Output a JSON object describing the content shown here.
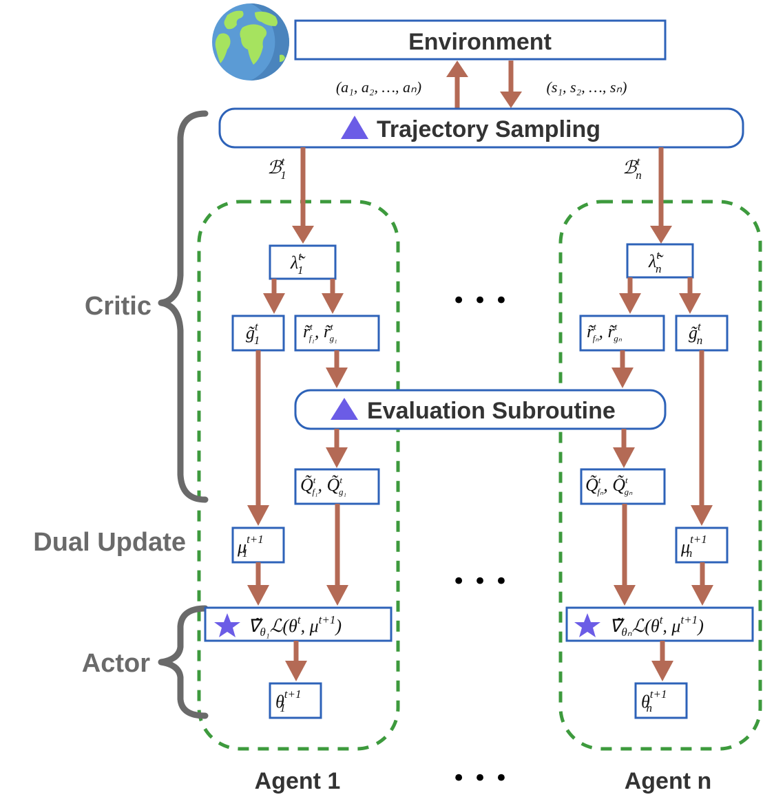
{
  "environment": {
    "title": "Environment",
    "icon": "globe-icon",
    "actions_label": "(a₁, a₂, …, aₙ)",
    "states_label": "(s₁, s₂, …, sₙ)"
  },
  "trajectory_sampling": {
    "label": "Trajectory Sampling",
    "icon": "triangle-icon"
  },
  "evaluation_subroutine": {
    "label": "Evaluation Subroutine",
    "icon": "triangle-icon"
  },
  "phases": {
    "critic": "Critic",
    "dual_update": "Dual Update",
    "actor": "Actor"
  },
  "agents": [
    {
      "name": "Agent 1",
      "batch": {
        "base": "ℬ",
        "sup": "t",
        "sub": "1"
      },
      "lambda": {
        "base": "λ̃",
        "sup": "t",
        "sub": "1"
      },
      "g": {
        "base": "g̃",
        "sup": "t",
        "sub": "1"
      },
      "r": {
        "base1": "r̃",
        "sup1": "t",
        "sub1": "f₁",
        "base2": "r̃",
        "sup2": "t",
        "sub2": "g₁"
      },
      "q": {
        "base1": "Q̃",
        "sup1": "t",
        "sub1": "f₁",
        "base2": "Q̃",
        "sup2": "t",
        "sub2": "g₁"
      },
      "mu": {
        "base": "μ",
        "sup": "t+1",
        "sub": "1"
      },
      "grad": {
        "nabla": "∇̃",
        "sub": "θ₁",
        "body": "ℒ(θ",
        "sup1": "t",
        "mid": ", μ",
        "sup2": "t+1",
        "close": ")"
      },
      "theta": {
        "base": "θ",
        "sup": "t+1",
        "sub": "1"
      }
    },
    {
      "name": "Agent n",
      "batch": {
        "base": "ℬ",
        "sup": "t",
        "sub": "n"
      },
      "lambda": {
        "base": "λ̃",
        "sup": "t",
        "sub": "n"
      },
      "g": {
        "base": "g̃",
        "sup": "t",
        "sub": "n"
      },
      "r": {
        "base1": "r̃",
        "sup1": "t",
        "sub1": "fₙ",
        "base2": "r̃",
        "sup2": "t",
        "sub2": "gₙ"
      },
      "q": {
        "base1": "Q̃",
        "sup1": "t",
        "sub1": "fₙ",
        "base2": "Q̃",
        "sup2": "t",
        "sub2": "gₙ"
      },
      "mu": {
        "base": "μ",
        "sup": "t+1",
        "sub": "n"
      },
      "grad": {
        "nabla": "∇̃",
        "sub": "θₙ",
        "body": "ℒ(θ",
        "sup1": "t",
        "mid": ", μ",
        "sup2": "t+1",
        "close": ")"
      },
      "theta": {
        "base": "θ",
        "sup": "t+1",
        "sub": "n"
      }
    }
  ],
  "ellipsis": "•  •  •",
  "colors": {
    "box_border": "#2d62b8",
    "arrow": "#b46a55",
    "agent_frame": "#3d9a3d",
    "accent_icon": "#6b5ce6",
    "phase_label": "#6a6a6a"
  }
}
